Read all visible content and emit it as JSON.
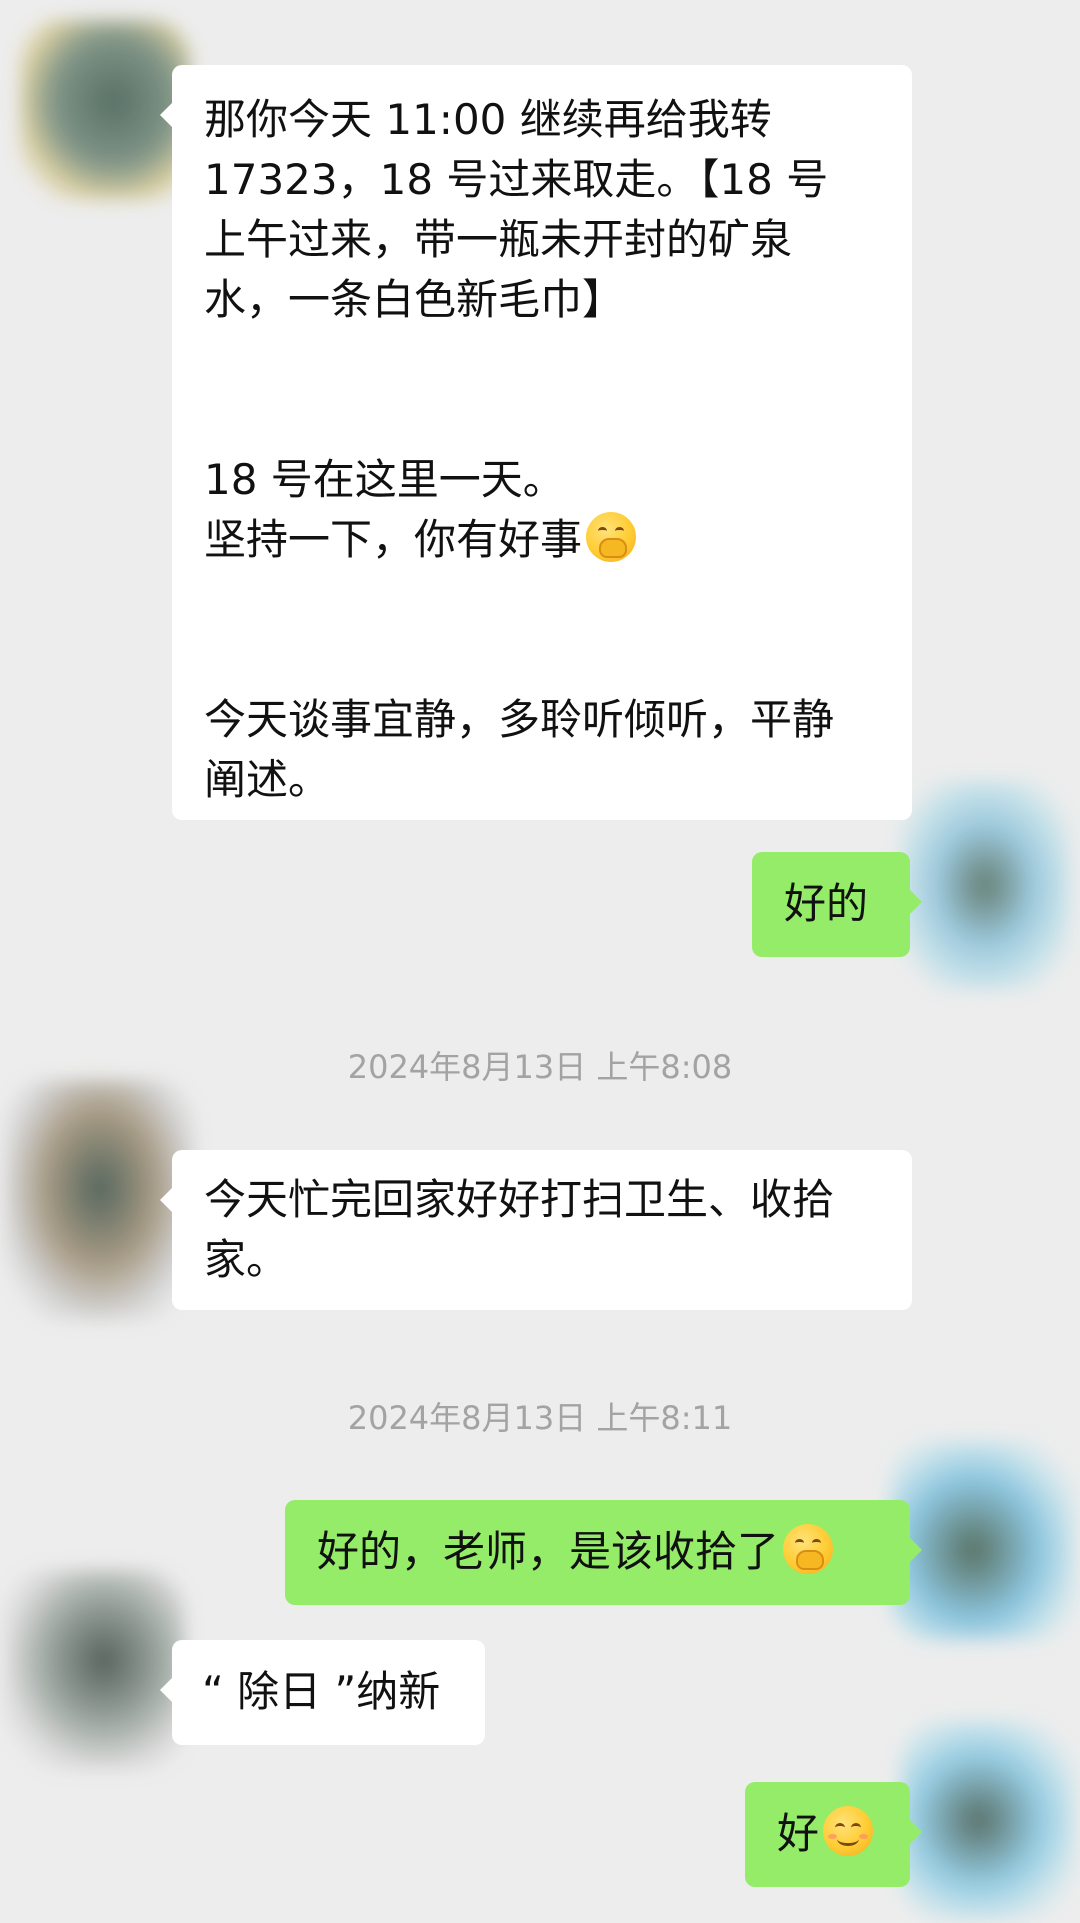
{
  "messages": [
    {
      "direction": "incoming",
      "lines": [
        "那你今天 11:00 继续再给我转",
        "17323，18 号过来取走。【18 号",
        "上午过来，带一瓶未开封的矿泉",
        "水，一条白色新毛巾】",
        "",
        "",
        "18 号在这里一天。",
        "坚持一下，你有好事",
        "",
        "",
        "今天谈事宜静，多聆听倾听，平静",
        "阐述。"
      ],
      "emoji": "hand-over-mouth-emoji"
    },
    {
      "direction": "outgoing",
      "text": "好的"
    },
    {
      "timestamp": "2024年8月13日 上午8:08"
    },
    {
      "direction": "incoming",
      "lines": [
        "今天忙完回家好好打扫卫生、收拾",
        "家。"
      ]
    },
    {
      "timestamp": "2024年8月13日 上午8:11"
    },
    {
      "direction": "outgoing",
      "text": "好的，老师，是该收拾了",
      "emoji": "hand-over-mouth-emoji"
    },
    {
      "direction": "incoming",
      "text": "“ 除日 ”纳新"
    },
    {
      "direction": "outgoing",
      "text": "好",
      "emoji": "smiling-face-emoji"
    }
  ],
  "colors": {
    "background": "#ededed",
    "incoming_bubble": "#ffffff",
    "outgoing_bubble": "#95ec69",
    "timestamp_text": "#a3a3a3",
    "message_text": "#111111"
  }
}
